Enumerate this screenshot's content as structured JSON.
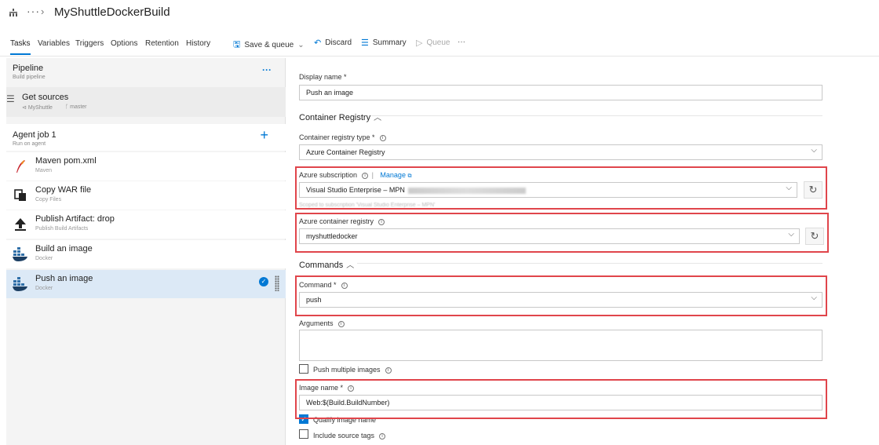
{
  "header": {
    "breadcrumb_more": "···",
    "pipeline_name": "MyShuttleDockerBuild"
  },
  "tabs": [
    "Tasks",
    "Variables",
    "Triggers",
    "Options",
    "Retention",
    "History"
  ],
  "toolbar": {
    "save_label": "Save & queue",
    "discard_label": "Discard",
    "summary_label": "Summary",
    "queue_label": "Queue",
    "more_label": "···"
  },
  "pipeline": {
    "title": "Pipeline",
    "subtitle": "Build pipeline",
    "more": "···"
  },
  "get_sources": {
    "title": "Get sources",
    "repo": "MyShuttle",
    "branch": "master"
  },
  "agent_job": {
    "title": "Agent job 1",
    "subtitle": "Run on agent"
  },
  "tasks": [
    {
      "title": "Maven pom.xml",
      "subtitle": "Maven",
      "icon": "maven-feather-icon"
    },
    {
      "title": "Copy WAR file",
      "subtitle": "Copy Files",
      "icon": "copy-files-icon"
    },
    {
      "title": "Publish Artifact: drop",
      "subtitle": "Publish Build Artifacts",
      "icon": "upload-icon"
    },
    {
      "title": "Build an image",
      "subtitle": "Docker",
      "icon": "docker-icon"
    },
    {
      "title": "Push an image",
      "subtitle": "Docker",
      "icon": "docker-icon",
      "selected": true
    }
  ],
  "form": {
    "display_name_label": "Display name *",
    "display_name_value": "Push an image",
    "container_registry_section": "Container Registry",
    "registry_type_label": "Container registry type *",
    "registry_type_value": "Azure Container Registry",
    "subscription_label": "Azure subscription",
    "subscription_manage": "Manage",
    "subscription_value": "Visual Studio Enterprise – MPN",
    "subscription_hint": "Scoped to subscription 'Visual Studio Enterprise – MPN'",
    "acr_label": "Azure container registry",
    "acr_value": "myshuttledocker",
    "commands_section": "Commands",
    "command_label": "Command *",
    "command_value": "push",
    "arguments_label": "Arguments",
    "arguments_value": "",
    "push_multiple_label": "Push multiple images",
    "image_name_label": "Image name *",
    "image_name_value": "Web:$(Build.BuildNumber)",
    "qualify_label": "Qualify image name",
    "include_tags_label": "Include source tags"
  },
  "colors": {
    "accent": "#0078d4",
    "highlight_box": "#e0454b",
    "selected_row": "#dce9f6"
  }
}
